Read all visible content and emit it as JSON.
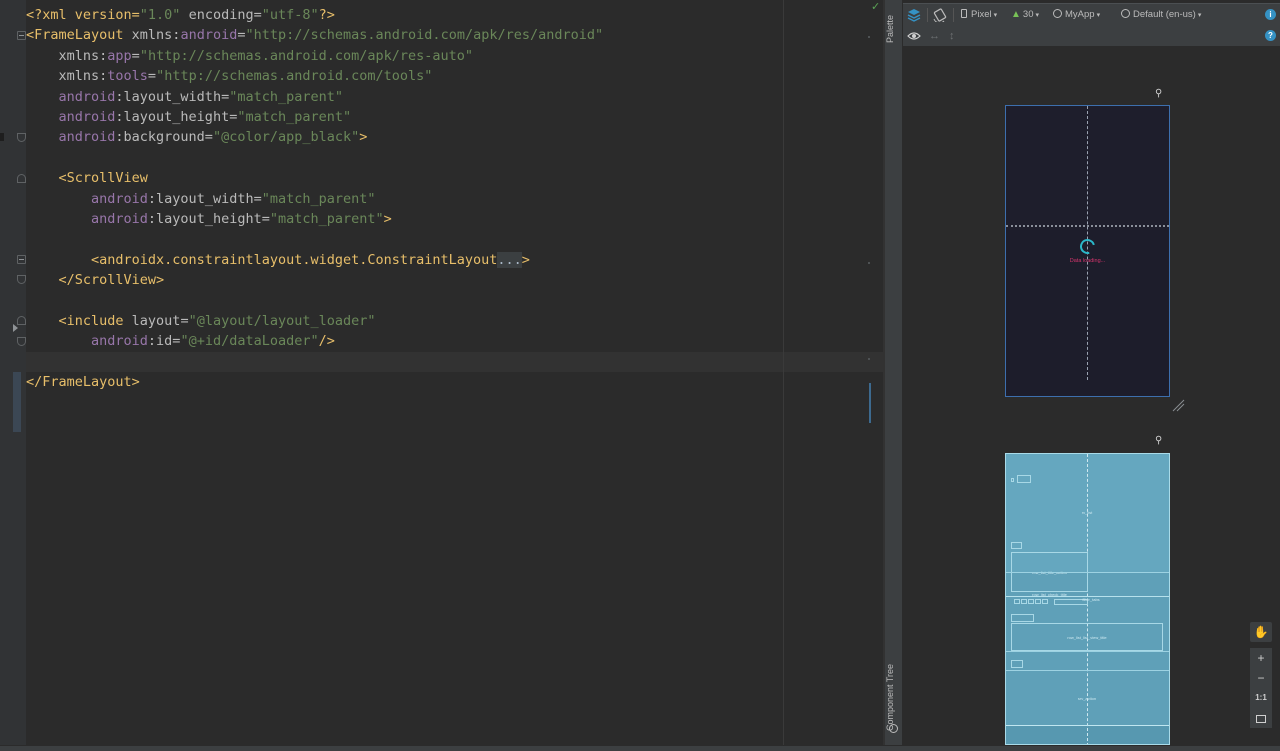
{
  "editor": {
    "lines": [
      {
        "segments": [
          {
            "t": "<?xml version=",
            "c": "t-tag"
          },
          {
            "t": "\"1.0\"",
            "c": "t-val"
          },
          {
            "t": " encoding=",
            "c": "t-attr"
          },
          {
            "t": "\"utf-8\"",
            "c": "t-val"
          },
          {
            "t": "?>",
            "c": "t-tag"
          }
        ]
      },
      {
        "segments": [
          {
            "t": "<FrameLayout ",
            "c": "t-tag"
          },
          {
            "t": "xmlns:",
            "c": "t-attr"
          },
          {
            "t": "android",
            "c": "t-ns"
          },
          {
            "t": "=",
            "c": "t-attr"
          },
          {
            "t": "\"http://schemas.android.com/apk/res/android\"",
            "c": "t-val"
          }
        ]
      },
      {
        "segments": [
          {
            "t": "    xmlns:",
            "c": "t-attr"
          },
          {
            "t": "app",
            "c": "t-ns"
          },
          {
            "t": "=",
            "c": "t-attr"
          },
          {
            "t": "\"http://schemas.android.com/apk/res-auto\"",
            "c": "t-val"
          }
        ]
      },
      {
        "segments": [
          {
            "t": "    xmlns:",
            "c": "t-attr"
          },
          {
            "t": "tools",
            "c": "t-ns"
          },
          {
            "t": "=",
            "c": "t-attr"
          },
          {
            "t": "\"http://schemas.android.com/tools\"",
            "c": "t-val"
          }
        ]
      },
      {
        "segments": [
          {
            "t": "    android",
            "c": "t-ns"
          },
          {
            "t": ":layout_width=",
            "c": "t-attr"
          },
          {
            "t": "\"match_parent\"",
            "c": "t-val"
          }
        ]
      },
      {
        "segments": [
          {
            "t": "    android",
            "c": "t-ns"
          },
          {
            "t": ":layout_height=",
            "c": "t-attr"
          },
          {
            "t": "\"match_parent\"",
            "c": "t-val"
          }
        ]
      },
      {
        "segments": [
          {
            "t": "    android",
            "c": "t-ns"
          },
          {
            "t": ":background=",
            "c": "t-attr"
          },
          {
            "t": "\"@color/app_black\"",
            "c": "t-val"
          },
          {
            "t": ">",
            "c": "t-tag"
          }
        ]
      },
      {
        "segments": []
      },
      {
        "segments": [
          {
            "t": "    <ScrollView",
            "c": "t-tag"
          }
        ]
      },
      {
        "segments": [
          {
            "t": "        android",
            "c": "t-ns"
          },
          {
            "t": ":layout_width=",
            "c": "t-attr"
          },
          {
            "t": "\"match_parent\"",
            "c": "t-val"
          }
        ]
      },
      {
        "segments": [
          {
            "t": "        android",
            "c": "t-ns"
          },
          {
            "t": ":layout_height=",
            "c": "t-attr"
          },
          {
            "t": "\"match_parent\"",
            "c": "t-val"
          },
          {
            "t": ">",
            "c": "t-tag"
          }
        ]
      },
      {
        "segments": []
      },
      {
        "segments": [
          {
            "t": "        <androidx.constraintlayout.widget.ConstraintLayout",
            "c": "t-tag"
          },
          {
            "t": "...",
            "c": "t-fold"
          },
          {
            "t": ">",
            "c": "t-tag"
          }
        ]
      },
      {
        "segments": [
          {
            "t": "    </ScrollView>",
            "c": "t-tag"
          }
        ]
      },
      {
        "segments": []
      },
      {
        "segments": [
          {
            "t": "    <include ",
            "c": "t-tag"
          },
          {
            "t": "layout=",
            "c": "t-attr"
          },
          {
            "t": "\"@layout/layout_loader\"",
            "c": "t-val"
          }
        ]
      },
      {
        "segments": [
          {
            "t": "        android",
            "c": "t-ns"
          },
          {
            "t": ":id=",
            "c": "t-attr"
          },
          {
            "t": "\"@+id/dataLoader\"",
            "c": "t-val"
          },
          {
            "t": "/>",
            "c": "t-tag"
          }
        ]
      },
      {
        "segments": []
      },
      {
        "segments": [
          {
            "t": "</FrameLayout>",
            "c": "t-tag"
          }
        ]
      }
    ]
  },
  "side_tabs": {
    "palette": "Palette",
    "component_tree": "Component Tree"
  },
  "toolbar": {
    "device": "Pixel",
    "api": "30",
    "theme": "MyApp",
    "locale": "Default (en-us)"
  },
  "design_preview": {
    "loader_text": "Data loading..."
  },
  "blueprint": {
    "labels": {
      "main": "rv_list",
      "box1": "row_list_title_action",
      "box2": "row_list_check_title",
      "box3": "row_list_list_view_title",
      "box4": "srv_action",
      "tag": "filter_tabs"
    }
  },
  "zoom": {
    "plus": "+",
    "minus": "−",
    "one_to_one": "1:1"
  },
  "colors": {
    "editor_bg": "#2b2b2b",
    "tag": "#e8bf6a",
    "namespace": "#9876aa",
    "value": "#6a8759",
    "blueprint": "#65a7bf",
    "accent": "#3592c4"
  }
}
